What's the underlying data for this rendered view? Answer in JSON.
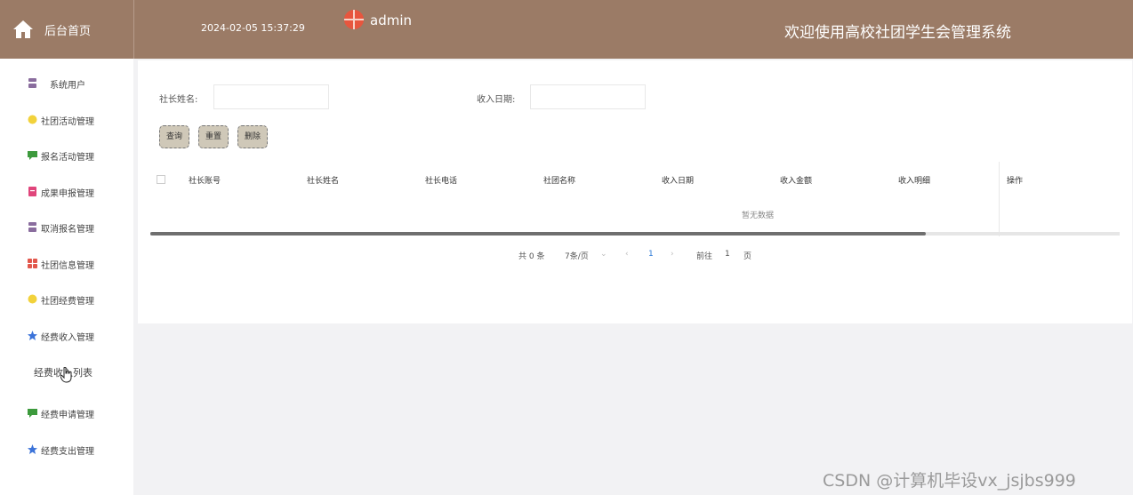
{
  "header": {
    "home_label": "后台首页",
    "datetime": "2024-02-05 15:37:29",
    "username": "admin",
    "welcome": "欢迎使用高校社团学生会管理系统",
    "color": "#9b7b66"
  },
  "sidebar": {
    "items": [
      {
        "label": "系统用户",
        "icon": "user-group-icon",
        "color": "#8a6d9e"
      },
      {
        "label": "社团活动管理",
        "icon": "circle-icon",
        "color": "#f2d23b"
      },
      {
        "label": "报名活动管理",
        "icon": "message-icon",
        "color": "#3c9a3c"
      },
      {
        "label": "成果申报管理",
        "icon": "document-icon",
        "color": "#e0457b"
      },
      {
        "label": "取消报名管理",
        "icon": "user-group-icon",
        "color": "#8a6d9e"
      },
      {
        "label": "社团信息管理",
        "icon": "grid-icon",
        "color": "#e2574c"
      },
      {
        "label": "社团经费管理",
        "icon": "circle-icon",
        "color": "#f2d23b"
      },
      {
        "label": "经费收入管理",
        "icon": "star-icon",
        "color": "#3b73d9"
      },
      {
        "label": "经费收入列表",
        "icon": "",
        "color": ""
      },
      {
        "label": "经费申请管理",
        "icon": "message-icon",
        "color": "#3c9a3c"
      },
      {
        "label": "经费支出管理",
        "icon": "star-icon",
        "color": "#3b73d9"
      }
    ]
  },
  "search": {
    "president_name_label": "社长姓名:",
    "president_name_value": "",
    "income_date_label": "收入日期:",
    "income_date_value": ""
  },
  "buttons": {
    "query": "查询",
    "reset": "重置",
    "delete": "删除"
  },
  "table": {
    "columns": [
      "社长账号",
      "社长姓名",
      "社长电话",
      "社团名称",
      "收入日期",
      "收入金额",
      "收入明细",
      "操作"
    ],
    "rows": [],
    "empty_text": "暂无数据",
    "horizontal_scroll_fraction": 0.8
  },
  "pagination": {
    "total": "共 0 条",
    "page_size": "7条/页",
    "current_page": "1",
    "goto_label": "前往",
    "goto_value": "1",
    "page_unit": "页"
  },
  "watermark": "CSDN @计算机毕设vx_jsjbs999"
}
